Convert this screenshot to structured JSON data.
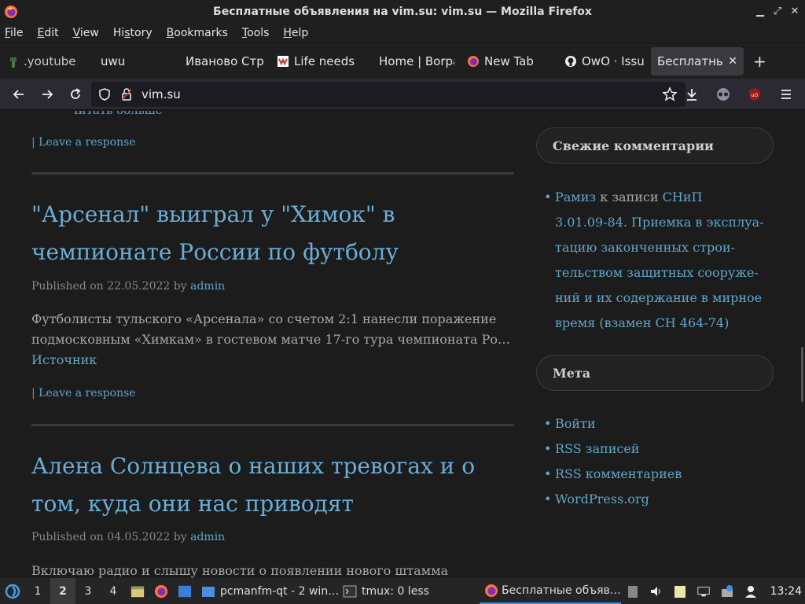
{
  "window": {
    "title": "Бесплатные объявления на vim.su: vim.su — Mozilla Firefox"
  },
  "menu": {
    "items": [
      {
        "label": "File",
        "accel": "F",
        "rest": "ile"
      },
      {
        "label": "Edit",
        "accel": "E",
        "rest": "dit"
      },
      {
        "label": "View",
        "accel": "V",
        "rest": "iew"
      },
      {
        "label": "History",
        "accel": "",
        "pre": "Hi",
        "mid": "s",
        "rest": "tory"
      },
      {
        "label": "Bookmarks",
        "accel": "B",
        "rest": "ookmarks"
      },
      {
        "label": "Tools",
        "accel": "T",
        "rest": "ools"
      },
      {
        "label": "Help",
        "accel": "H",
        "rest": "elp"
      }
    ]
  },
  "tabs": [
    {
      "label": ".youtube -",
      "icon": "youtube-icon"
    },
    {
      "label": "uwu",
      "icon": ""
    },
    {
      "label": "Иваново Стр",
      "icon": ""
    },
    {
      "label": "Life needs",
      "icon": "life-icon"
    },
    {
      "label": "Home | Borpa",
      "icon": ""
    },
    {
      "label": "New Tab",
      "icon": "firefox-icon"
    },
    {
      "label": "OwO · Issu",
      "icon": "github-icon"
    },
    {
      "label": "Бесплатны",
      "icon": "",
      "active": true
    }
  ],
  "navbar": {
    "url": "vim.su"
  },
  "content": {
    "cut_top_text": "Читать больше",
    "posts": [
      {
        "response_prefix": "|",
        "response_link": "Leave a response"
      },
      {
        "title": "\"Арсенал\" выиграл у \"Химок\" в чемпионате России по футболу",
        "meta_prefix": "Published on",
        "date": "22.05.2022",
        "by": "by",
        "author": "admin",
        "excerpt": "Футболисты тульского «Арсенала» со счетом 2:1 нанесли поражение подмосковным «Химкам» в гостевом матче 17-го тура чемпионата Ро…",
        "source_link": "Источник",
        "response_prefix": "|",
        "response_link": "Leave a response"
      },
      {
        "title": "Алена Солнцева о наших тревогах и о том, куда они нас приводят",
        "meta_prefix": "Published on",
        "date": "04.05.2022",
        "by": "by",
        "author": "admin",
        "excerpt": "Включаю радио и слышу новости о появлении нового штамма"
      }
    ]
  },
  "sidebar": {
    "recent_comments_title": "Свежие комментарии",
    "comment": {
      "author": "Рамиз",
      "to": "к записи",
      "post_lines": [
        "СНиП",
        "3.01.09-84. Приемка в эксплуа-",
        "тацию законченных строи-",
        "тельством защитных сооруже-",
        "ний и их содержание в мирное",
        "время (взамен СН 464-74)"
      ]
    },
    "meta_title": "Мета",
    "meta_links": [
      "Войти",
      "RSS записей",
      "RSS комментариев",
      "WordPress.org"
    ]
  },
  "taskbar": {
    "workspaces": [
      "1",
      "2",
      "3",
      "4"
    ],
    "active_workspace": "2",
    "windows": [
      {
        "label": "pcmanfm-qt - 2 win…",
        "icon": "folder-icon"
      },
      {
        "label": "tmux: 0 less",
        "icon": "terminal-icon"
      },
      {
        "label": "Бесплатные объяв…",
        "icon": "firefox-icon",
        "active": true
      }
    ],
    "clock": "13:24"
  }
}
